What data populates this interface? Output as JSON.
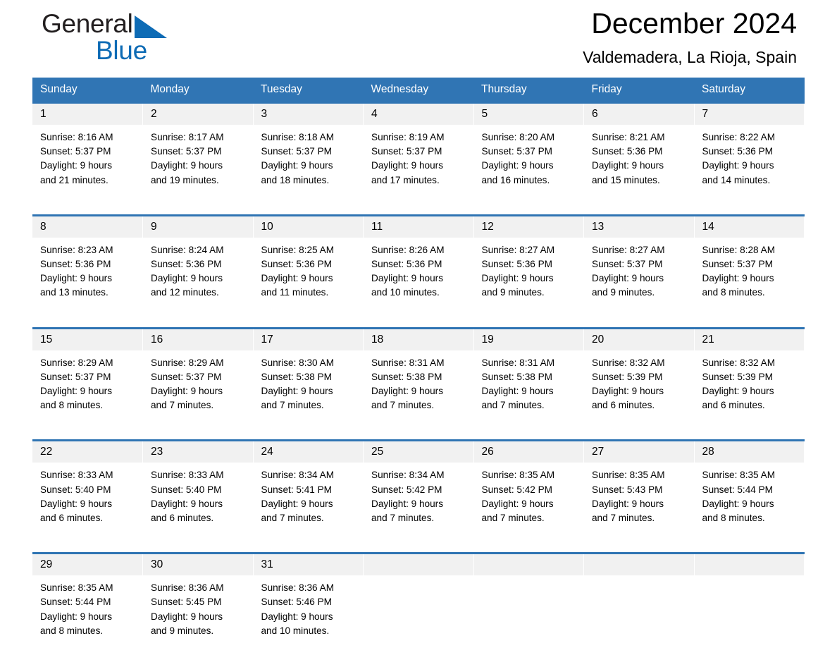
{
  "brand": {
    "name_part1": "General",
    "name_part2": "Blue",
    "triangle_color": "#0d6bb5",
    "text_color": "#231f20"
  },
  "header": {
    "month_title": "December 2024",
    "location": "Valdemadera, La Rioja, Spain"
  },
  "theme": {
    "header_blue": "#3075b4",
    "row_border_blue": "#2f74b3",
    "daynum_background": "#f1f1f1",
    "cell_background": "#ffffff",
    "text": "#000000"
  },
  "calendar": {
    "weekdays": [
      "Sunday",
      "Monday",
      "Tuesday",
      "Wednesday",
      "Thursday",
      "Friday",
      "Saturday"
    ],
    "labels": {
      "sunrise": "Sunrise:",
      "sunset": "Sunset:",
      "daylight": "Daylight:"
    },
    "weeks": [
      [
        {
          "day": "1",
          "sunrise": "Sunrise: 8:16 AM",
          "sunset": "Sunset: 5:37 PM",
          "daylight_line1": "Daylight: 9 hours",
          "daylight_line2": "and 21 minutes."
        },
        {
          "day": "2",
          "sunrise": "Sunrise: 8:17 AM",
          "sunset": "Sunset: 5:37 PM",
          "daylight_line1": "Daylight: 9 hours",
          "daylight_line2": "and 19 minutes."
        },
        {
          "day": "3",
          "sunrise": "Sunrise: 8:18 AM",
          "sunset": "Sunset: 5:37 PM",
          "daylight_line1": "Daylight: 9 hours",
          "daylight_line2": "and 18 minutes."
        },
        {
          "day": "4",
          "sunrise": "Sunrise: 8:19 AM",
          "sunset": "Sunset: 5:37 PM",
          "daylight_line1": "Daylight: 9 hours",
          "daylight_line2": "and 17 minutes."
        },
        {
          "day": "5",
          "sunrise": "Sunrise: 8:20 AM",
          "sunset": "Sunset: 5:37 PM",
          "daylight_line1": "Daylight: 9 hours",
          "daylight_line2": "and 16 minutes."
        },
        {
          "day": "6",
          "sunrise": "Sunrise: 8:21 AM",
          "sunset": "Sunset: 5:36 PM",
          "daylight_line1": "Daylight: 9 hours",
          "daylight_line2": "and 15 minutes."
        },
        {
          "day": "7",
          "sunrise": "Sunrise: 8:22 AM",
          "sunset": "Sunset: 5:36 PM",
          "daylight_line1": "Daylight: 9 hours",
          "daylight_line2": "and 14 minutes."
        }
      ],
      [
        {
          "day": "8",
          "sunrise": "Sunrise: 8:23 AM",
          "sunset": "Sunset: 5:36 PM",
          "daylight_line1": "Daylight: 9 hours",
          "daylight_line2": "and 13 minutes."
        },
        {
          "day": "9",
          "sunrise": "Sunrise: 8:24 AM",
          "sunset": "Sunset: 5:36 PM",
          "daylight_line1": "Daylight: 9 hours",
          "daylight_line2": "and 12 minutes."
        },
        {
          "day": "10",
          "sunrise": "Sunrise: 8:25 AM",
          "sunset": "Sunset: 5:36 PM",
          "daylight_line1": "Daylight: 9 hours",
          "daylight_line2": "and 11 minutes."
        },
        {
          "day": "11",
          "sunrise": "Sunrise: 8:26 AM",
          "sunset": "Sunset: 5:36 PM",
          "daylight_line1": "Daylight: 9 hours",
          "daylight_line2": "and 10 minutes."
        },
        {
          "day": "12",
          "sunrise": "Sunrise: 8:27 AM",
          "sunset": "Sunset: 5:36 PM",
          "daylight_line1": "Daylight: 9 hours",
          "daylight_line2": "and 9 minutes."
        },
        {
          "day": "13",
          "sunrise": "Sunrise: 8:27 AM",
          "sunset": "Sunset: 5:37 PM",
          "daylight_line1": "Daylight: 9 hours",
          "daylight_line2": "and 9 minutes."
        },
        {
          "day": "14",
          "sunrise": "Sunrise: 8:28 AM",
          "sunset": "Sunset: 5:37 PM",
          "daylight_line1": "Daylight: 9 hours",
          "daylight_line2": "and 8 minutes."
        }
      ],
      [
        {
          "day": "15",
          "sunrise": "Sunrise: 8:29 AM",
          "sunset": "Sunset: 5:37 PM",
          "daylight_line1": "Daylight: 9 hours",
          "daylight_line2": "and 8 minutes."
        },
        {
          "day": "16",
          "sunrise": "Sunrise: 8:29 AM",
          "sunset": "Sunset: 5:37 PM",
          "daylight_line1": "Daylight: 9 hours",
          "daylight_line2": "and 7 minutes."
        },
        {
          "day": "17",
          "sunrise": "Sunrise: 8:30 AM",
          "sunset": "Sunset: 5:38 PM",
          "daylight_line1": "Daylight: 9 hours",
          "daylight_line2": "and 7 minutes."
        },
        {
          "day": "18",
          "sunrise": "Sunrise: 8:31 AM",
          "sunset": "Sunset: 5:38 PM",
          "daylight_line1": "Daylight: 9 hours",
          "daylight_line2": "and 7 minutes."
        },
        {
          "day": "19",
          "sunrise": "Sunrise: 8:31 AM",
          "sunset": "Sunset: 5:38 PM",
          "daylight_line1": "Daylight: 9 hours",
          "daylight_line2": "and 7 minutes."
        },
        {
          "day": "20",
          "sunrise": "Sunrise: 8:32 AM",
          "sunset": "Sunset: 5:39 PM",
          "daylight_line1": "Daylight: 9 hours",
          "daylight_line2": "and 6 minutes."
        },
        {
          "day": "21",
          "sunrise": "Sunrise: 8:32 AM",
          "sunset": "Sunset: 5:39 PM",
          "daylight_line1": "Daylight: 9 hours",
          "daylight_line2": "and 6 minutes."
        }
      ],
      [
        {
          "day": "22",
          "sunrise": "Sunrise: 8:33 AM",
          "sunset": "Sunset: 5:40 PM",
          "daylight_line1": "Daylight: 9 hours",
          "daylight_line2": "and 6 minutes."
        },
        {
          "day": "23",
          "sunrise": "Sunrise: 8:33 AM",
          "sunset": "Sunset: 5:40 PM",
          "daylight_line1": "Daylight: 9 hours",
          "daylight_line2": "and 6 minutes."
        },
        {
          "day": "24",
          "sunrise": "Sunrise: 8:34 AM",
          "sunset": "Sunset: 5:41 PM",
          "daylight_line1": "Daylight: 9 hours",
          "daylight_line2": "and 7 minutes."
        },
        {
          "day": "25",
          "sunrise": "Sunrise: 8:34 AM",
          "sunset": "Sunset: 5:42 PM",
          "daylight_line1": "Daylight: 9 hours",
          "daylight_line2": "and 7 minutes."
        },
        {
          "day": "26",
          "sunrise": "Sunrise: 8:35 AM",
          "sunset": "Sunset: 5:42 PM",
          "daylight_line1": "Daylight: 9 hours",
          "daylight_line2": "and 7 minutes."
        },
        {
          "day": "27",
          "sunrise": "Sunrise: 8:35 AM",
          "sunset": "Sunset: 5:43 PM",
          "daylight_line1": "Daylight: 9 hours",
          "daylight_line2": "and 7 minutes."
        },
        {
          "day": "28",
          "sunrise": "Sunrise: 8:35 AM",
          "sunset": "Sunset: 5:44 PM",
          "daylight_line1": "Daylight: 9 hours",
          "daylight_line2": "and 8 minutes."
        }
      ],
      [
        {
          "day": "29",
          "sunrise": "Sunrise: 8:35 AM",
          "sunset": "Sunset: 5:44 PM",
          "daylight_line1": "Daylight: 9 hours",
          "daylight_line2": "and 8 minutes."
        },
        {
          "day": "30",
          "sunrise": "Sunrise: 8:36 AM",
          "sunset": "Sunset: 5:45 PM",
          "daylight_line1": "Daylight: 9 hours",
          "daylight_line2": "and 9 minutes."
        },
        {
          "day": "31",
          "sunrise": "Sunrise: 8:36 AM",
          "sunset": "Sunset: 5:46 PM",
          "daylight_line1": "Daylight: 9 hours",
          "daylight_line2": "and 10 minutes."
        },
        {
          "day": "",
          "sunrise": "",
          "sunset": "",
          "daylight_line1": "",
          "daylight_line2": ""
        },
        {
          "day": "",
          "sunrise": "",
          "sunset": "",
          "daylight_line1": "",
          "daylight_line2": ""
        },
        {
          "day": "",
          "sunrise": "",
          "sunset": "",
          "daylight_line1": "",
          "daylight_line2": ""
        },
        {
          "day": "",
          "sunrise": "",
          "sunset": "",
          "daylight_line1": "",
          "daylight_line2": ""
        }
      ]
    ]
  }
}
